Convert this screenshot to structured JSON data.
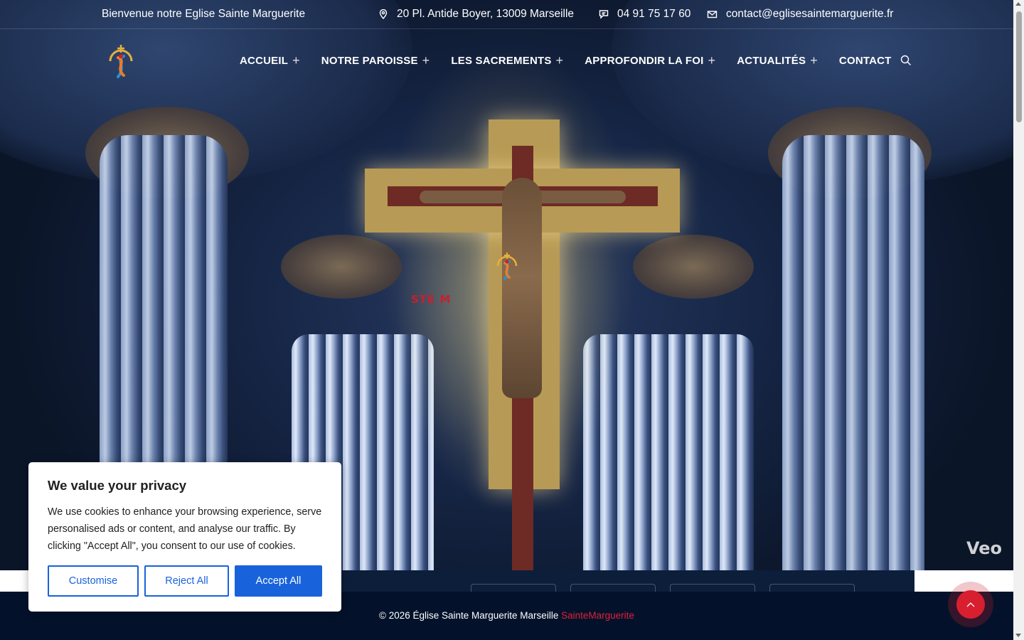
{
  "topbar": {
    "welcome": "Bienvenue notre Eglise Sainte Marguerite",
    "address": "20 Pl. Antide Boyer, 13009 Marseille",
    "phone": "04 91 75 17 60",
    "email": "contact@eglisesaintemarguerite.fr"
  },
  "nav": {
    "items": [
      {
        "label": "ACCUEIL",
        "has_submenu": true
      },
      {
        "label": "NOTRE PAROISSE",
        "has_submenu": true
      },
      {
        "label": "LES SACREMENTS",
        "has_submenu": true
      },
      {
        "label": "APPROFONDIR LA FOI",
        "has_submenu": true
      },
      {
        "label": "ACTUALITÉS",
        "has_submenu": true
      },
      {
        "label": "CONTACT",
        "has_submenu": false
      }
    ],
    "submenu_symbol": "+"
  },
  "hero": {
    "overlay_text": "STE M",
    "watermark": "Veo"
  },
  "footer": {
    "copyright": "© 2026 Église Sainte Marguerite Marseille",
    "brand": "SainteMarguerite"
  },
  "cookie": {
    "title": "We value your privacy",
    "body": "We use cookies to enhance your browsing experience, serve personalised ads or content, and analyse our traffic. By clicking \"Accept All\", you consent to our use of cookies.",
    "customise": "Customise",
    "reject": "Reject All",
    "accept": "Accept All"
  },
  "colors": {
    "accent_red": "#d81f30",
    "cookie_blue": "#1863dc",
    "footer_navy": "#03122a"
  },
  "icons": {
    "address": "map-pin-icon",
    "phone": "chat-phone-icon",
    "email": "envelope-icon",
    "search": "search-icon",
    "scroll_top": "chevron-up-icon"
  }
}
